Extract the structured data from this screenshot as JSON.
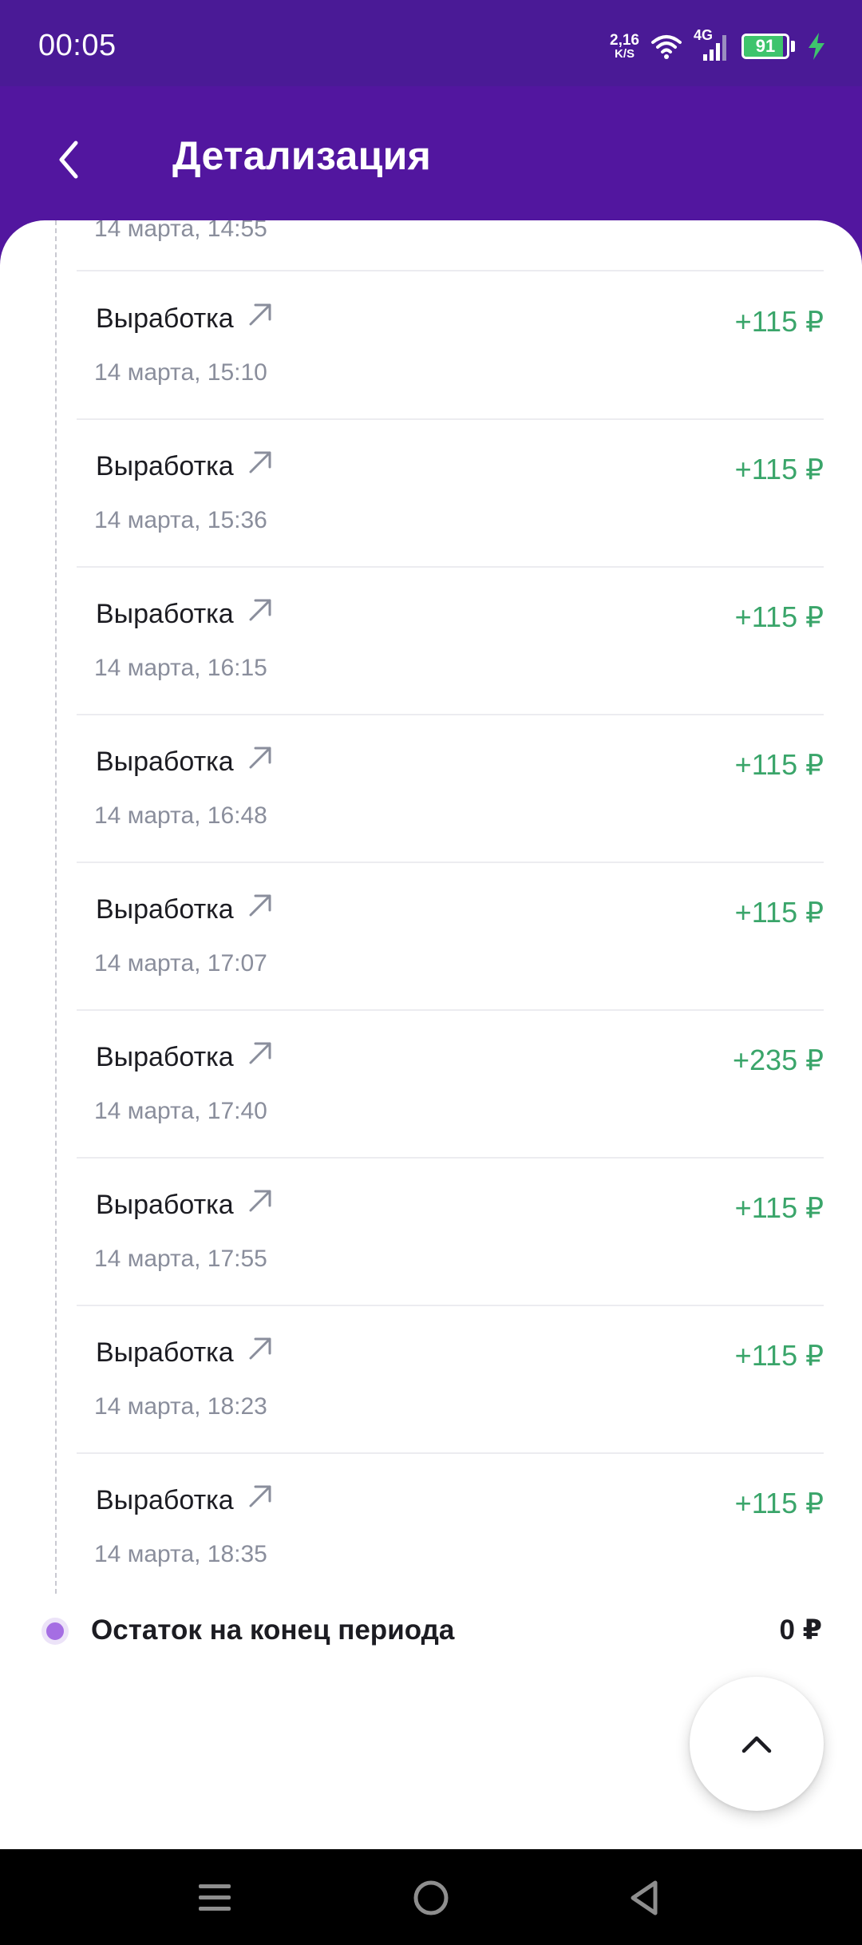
{
  "status_bar": {
    "time": "00:05",
    "net_speed_value": "2,16",
    "net_speed_unit": "K/S",
    "network_type": "4G",
    "battery_level": "91",
    "battery_fraction": 0.91
  },
  "header": {
    "title": "Детализация"
  },
  "list": {
    "partial_date": "14 марта, 14:55",
    "transactions": [
      {
        "label": "Выработка",
        "date": "14 марта, 15:10",
        "amount": "+115 ₽"
      },
      {
        "label": "Выработка",
        "date": "14 марта, 15:36",
        "amount": "+115 ₽"
      },
      {
        "label": "Выработка",
        "date": "14 марта, 16:15",
        "amount": "+115 ₽"
      },
      {
        "label": "Выработка",
        "date": "14 марта, 16:48",
        "amount": "+115 ₽"
      },
      {
        "label": "Выработка",
        "date": "14 марта, 17:07",
        "amount": "+115 ₽"
      },
      {
        "label": "Выработка",
        "date": "14 марта, 17:40",
        "amount": "+235 ₽"
      },
      {
        "label": "Выработка",
        "date": "14 марта, 17:55",
        "amount": "+115 ₽"
      },
      {
        "label": "Выработка",
        "date": "14 марта, 18:23",
        "amount": "+115 ₽"
      },
      {
        "label": "Выработка",
        "date": "14 марта, 18:35",
        "amount": "+115 ₽"
      }
    ]
  },
  "balance": {
    "label": "Остаток на конец периода",
    "value": "0 ₽"
  },
  "colors": {
    "header": "#52169f",
    "status_bar": "#4a1a96",
    "positive_amount": "#3aa56a",
    "timeline_dot": "#a56ee3"
  },
  "icons": [
    "back-icon",
    "external-link-arrow-icon",
    "chevron-up-icon",
    "wifi-icon",
    "signal-icon",
    "battery-icon",
    "charging-icon",
    "menu-icon",
    "home-icon",
    "back-nav-icon"
  ]
}
